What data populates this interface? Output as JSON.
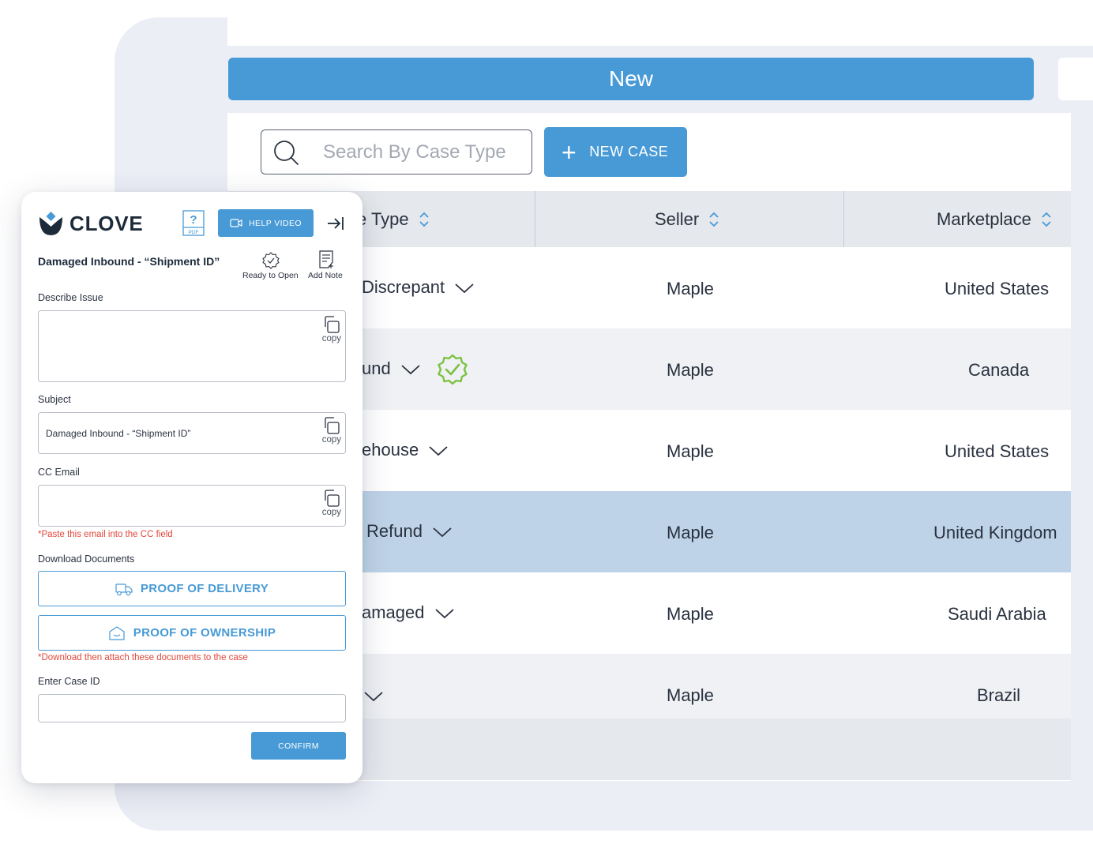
{
  "app": {
    "status_bar_label": "New",
    "search": {
      "placeholder": "Search By Case Type"
    },
    "new_case_label": "NEW CASE"
  },
  "table": {
    "headers": {
      "type": "e Type",
      "seller": "Seller",
      "marketplace": "Marketplace"
    },
    "rows": [
      {
        "type": "Discrepant",
        "seller": "Maple",
        "marketplace": "United States",
        "verified": false,
        "highlighted": false,
        "shaded": false
      },
      {
        "type": "und",
        "seller": "Maple",
        "marketplace": "Canada",
        "verified": true,
        "highlighted": false,
        "shaded": true
      },
      {
        "type": "ehouse",
        "seller": "Maple",
        "marketplace": "United States",
        "verified": false,
        "highlighted": false,
        "shaded": false
      },
      {
        "type": "Refund",
        "seller": "Maple",
        "marketplace": "United Kingdom",
        "verified": false,
        "highlighted": true,
        "shaded": false
      },
      {
        "type": "amaged",
        "seller": "Maple",
        "marketplace": "Saudi Arabia",
        "verified": false,
        "highlighted": false,
        "shaded": false
      },
      {
        "type": "",
        "seller": "Maple",
        "marketplace": "Brazil",
        "verified": false,
        "highlighted": false,
        "shaded": true
      }
    ]
  },
  "panel": {
    "brand": "CLOVE",
    "pdf_label": "PDF",
    "pdf_symbol": "?",
    "help_video_label": "HELP VIDEO",
    "case_title": "Damaged Inbound - “Shipment ID”",
    "ready_to_open_label": "Ready to Open",
    "add_note_label": "Add Note",
    "describe_issue_label": "Describe Issue",
    "describe_issue_value": "",
    "subject_label": "Subject",
    "subject_value": "Damaged Inbound - “Shipment ID”",
    "cc_email_label": "CC Email",
    "cc_email_value": "",
    "cc_email_hint": "*Paste this email into the CC field",
    "copy_label": "copy",
    "download_documents_label": "Download Documents",
    "proof_of_delivery_label": "PROOF OF DELIVERY",
    "proof_of_ownership_label": "PROOF OF OWNERSHIP",
    "download_hint": "*Download then attach these documents to the case",
    "enter_case_id_label": "Enter Case ID",
    "case_id_value": "",
    "confirm_label": "CONFIRM"
  },
  "colors": {
    "accent": "#479ad6",
    "highlight_row": "#bfd3e8",
    "shaded_row": "#eff1f4",
    "verified_badge": "#7cc242",
    "warning": "#e2473b"
  }
}
